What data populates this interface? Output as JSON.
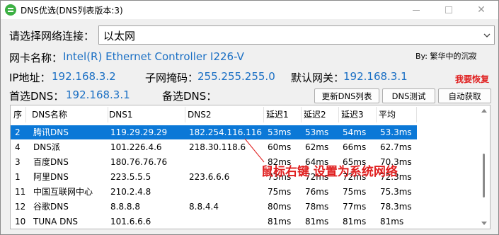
{
  "window": {
    "title": "DNS优选(DNS列表版本:3)",
    "icon": "app-logo-icon",
    "controls": [
      "minimize-icon",
      "maximize-icon",
      "close-icon"
    ]
  },
  "network": {
    "select_label": "请选择网络连接：",
    "selected": "以太网",
    "nic_label": "网卡名称：",
    "nic_value": "Intel(R) Ethernet Controller I226-V",
    "ip_label": "IP地址：",
    "ip_value": "192.168.3.2",
    "mask_label": "子网掩码：",
    "mask_value": "255.255.255.0",
    "gateway_label": "默认网关：",
    "gateway_value": "192.168.3.1",
    "primary_label": "首选DNS：",
    "primary_value": "192.168.3.1",
    "secondary_label": "备选DNS：",
    "secondary_value": ""
  },
  "author": "By: 繁华中的沉寂",
  "restore_label": "我要恢复",
  "buttons": {
    "update": "更新DNS列表",
    "test": "DNS测试",
    "auto": "自动获取"
  },
  "table": {
    "headers": [
      "序",
      "DNS名称",
      "DNS1",
      "DNS2",
      "延迟1",
      "延迟2",
      "延迟3",
      "平均"
    ],
    "rows": [
      [
        "2",
        "腾讯DNS",
        "119.29.29.29",
        "182.254.116.116",
        "53ms",
        "53ms",
        "54ms",
        "53.3ms"
      ],
      [
        "4",
        "DNS派",
        "101.226.4.6",
        "218.30.118.6",
        "60ms",
        "62ms",
        "66ms",
        "62.7ms"
      ],
      [
        "3",
        "百度DNS",
        "180.76.76.76",
        "",
        "82ms",
        "64ms",
        "65ms",
        "70.3ms"
      ],
      [
        "1",
        "阿里DNS",
        "223.5.5.5",
        "223.6.6.6",
        "73ms",
        "72ms",
        "72ms",
        "72.3ms"
      ],
      [
        "11",
        "中国互联网中心",
        "210.2.4.8",
        "",
        "75ms",
        "76ms",
        "75ms",
        "75.3ms"
      ],
      [
        "12",
        "谷歌DNS",
        "8.8.8.8",
        "8.8.4.4",
        "80ms",
        "78ms",
        "77ms",
        "78.3ms"
      ],
      [
        "10",
        "TUNA DNS",
        "101.6.6.6",
        "",
        "81ms",
        "81ms",
        "81ms",
        "81ms"
      ]
    ],
    "selected_row": 0
  },
  "annotation": "鼠标右键 设置为系统网络",
  "colors": {
    "selection": "#0b78d7",
    "value_blue": "#1a6fc4",
    "annotation_red": "#e02020"
  }
}
